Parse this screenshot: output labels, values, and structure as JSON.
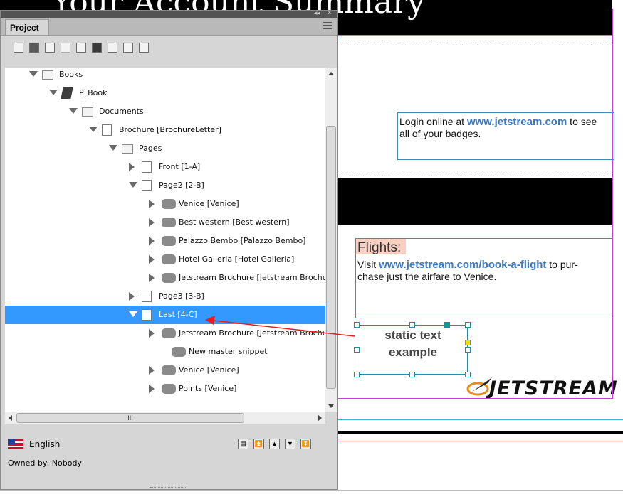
{
  "document": {
    "heading": "Your Account Summary",
    "login_line_1_prefix": "Login online at ",
    "login_link": "www.jetstream.com",
    "login_line_1_suffix": " to see",
    "login_line_2": "all of your badges.",
    "flights_heading": "Flights:",
    "flights_prefix": "Visit ",
    "flights_link": "www.jetstream.com/book-a-flight",
    "flights_suffix": " to pur-",
    "flights_line_2": "chase just the airfare to Venice.",
    "static_text_line_1": "static text",
    "static_text_line_2": "example",
    "logo_text": "JETSTREAM",
    "colors": {
      "link": "#3b78c2",
      "flights_highlight": "#f9cfc2",
      "selection": "#3399ff",
      "guide_cyan": "#3fb7c7",
      "guide_magenta": "#c43dd8",
      "arrow": "#e02020"
    }
  },
  "panel": {
    "title": "Project",
    "window_controls": {
      "collapse": "◂◂",
      "close": "×"
    },
    "menu_icon": "panel-menu-icon",
    "toolbar_icons": [
      "select-icon",
      "save-icon",
      "checkin-icon",
      "add-icon",
      "copy-icon",
      "delete-icon",
      "preview-icon",
      "page-icon",
      "settings-icon"
    ],
    "tree": [
      {
        "label": "Books",
        "icon": "folder-icon",
        "state": "open"
      },
      {
        "label": "P_Book",
        "icon": "book-icon",
        "state": "open"
      },
      {
        "label": "Documents",
        "icon": "folder-icon",
        "state": "open"
      },
      {
        "label": "Brochure [BrochureLetter]",
        "icon": "document-icon",
        "state": "open"
      },
      {
        "label": "Pages",
        "icon": "folder-icon",
        "state": "open"
      },
      {
        "label": "Front [1-A]",
        "icon": "page-icon",
        "state": "closed"
      },
      {
        "label": "Page2 [2-B]",
        "icon": "page-icon",
        "state": "open"
      },
      {
        "label": "Venice [Venice]",
        "icon": "snippet-icon",
        "state": "closed"
      },
      {
        "label": "Best western [Best western]",
        "icon": "snippet-icon",
        "state": "closed"
      },
      {
        "label": "Palazzo Bembo [Palazzo Bembo]",
        "icon": "snippet-icon",
        "state": "closed"
      },
      {
        "label": "Hotel Galleria [Hotel Galleria]",
        "icon": "snippet-icon",
        "state": "closed"
      },
      {
        "label": "Jetstream Brochure [Jetstream Brochu",
        "icon": "snippet-icon",
        "state": "closed"
      },
      {
        "label": "Page3 [3-B]",
        "icon": "page-icon",
        "state": "closed"
      },
      {
        "label": "Last [4-C]",
        "icon": "page-icon",
        "state": "open",
        "selected": true
      },
      {
        "label": "Jetstream Brochure [Jetstream Brochu",
        "icon": "snippet-icon",
        "state": "closed"
      },
      {
        "label": "New master snippet",
        "icon": "snippet-icon",
        "state": "none"
      },
      {
        "label": "Venice [Venice]",
        "icon": "snippet-icon",
        "state": "closed"
      },
      {
        "label": "Points [Venice]",
        "icon": "snippet-icon",
        "state": "closed"
      }
    ],
    "hscroll_grip": "III",
    "language": "English",
    "owner": "Owned by: Nobody",
    "footer_icons": [
      "tree-view-icon",
      "move-top-icon",
      "move-up-icon",
      "move-down-icon",
      "move-bottom-icon"
    ]
  }
}
